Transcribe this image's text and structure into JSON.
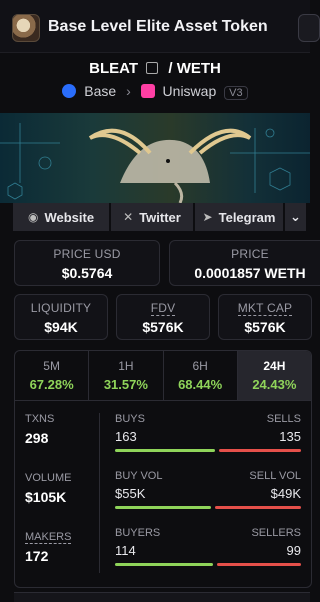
{
  "header": {
    "title": "Base Level Elite Asset Token"
  },
  "pair": {
    "base": "BLEAT",
    "sep": "/",
    "quote": "WETH"
  },
  "chain": {
    "network": "Base",
    "dex": "Uniswap",
    "version": "V3"
  },
  "links": [
    {
      "label": "Website",
      "icon": "globe-icon"
    },
    {
      "label": "Twitter",
      "icon": "x-icon"
    },
    {
      "label": "Telegram",
      "icon": "telegram-icon"
    }
  ],
  "prices": {
    "usd_label": "PRICE USD",
    "usd": "$0.5764",
    "native_label": "PRICE",
    "native": "0.0001857 WETH"
  },
  "metrics": [
    {
      "label": "LIQUIDITY",
      "value": "$94K"
    },
    {
      "label": "FDV",
      "value": "$576K"
    },
    {
      "label": "MKT CAP",
      "value": "$576K"
    }
  ],
  "tabs": [
    {
      "label": "5M",
      "pct": "67.28%"
    },
    {
      "label": "1H",
      "pct": "31.57%"
    },
    {
      "label": "6H",
      "pct": "68.44%"
    },
    {
      "label": "24H",
      "pct": "24.43%"
    }
  ],
  "stats": {
    "txns_label": "TXNS",
    "txns": "298",
    "volume_label": "VOLUME",
    "volume": "$105K",
    "makers_label": "MAKERS",
    "makers": "172",
    "buys_label": "BUYS",
    "buys": "163",
    "sells_label": "SELLS",
    "sells": "135",
    "buyvol_label": "BUY VOL",
    "buyvol": "$55K",
    "sellvol_label": "SELL VOL",
    "sellvol": "$49K",
    "buyers_label": "BUYERS",
    "buyers": "114",
    "sellers_label": "SELLERS",
    "sellers": "99"
  },
  "colors": {
    "accent_green": "#8fd45a",
    "accent_red": "#e5504a",
    "base_blue": "#2a6dfb",
    "uniswap_pink": "#ff3fa4"
  }
}
